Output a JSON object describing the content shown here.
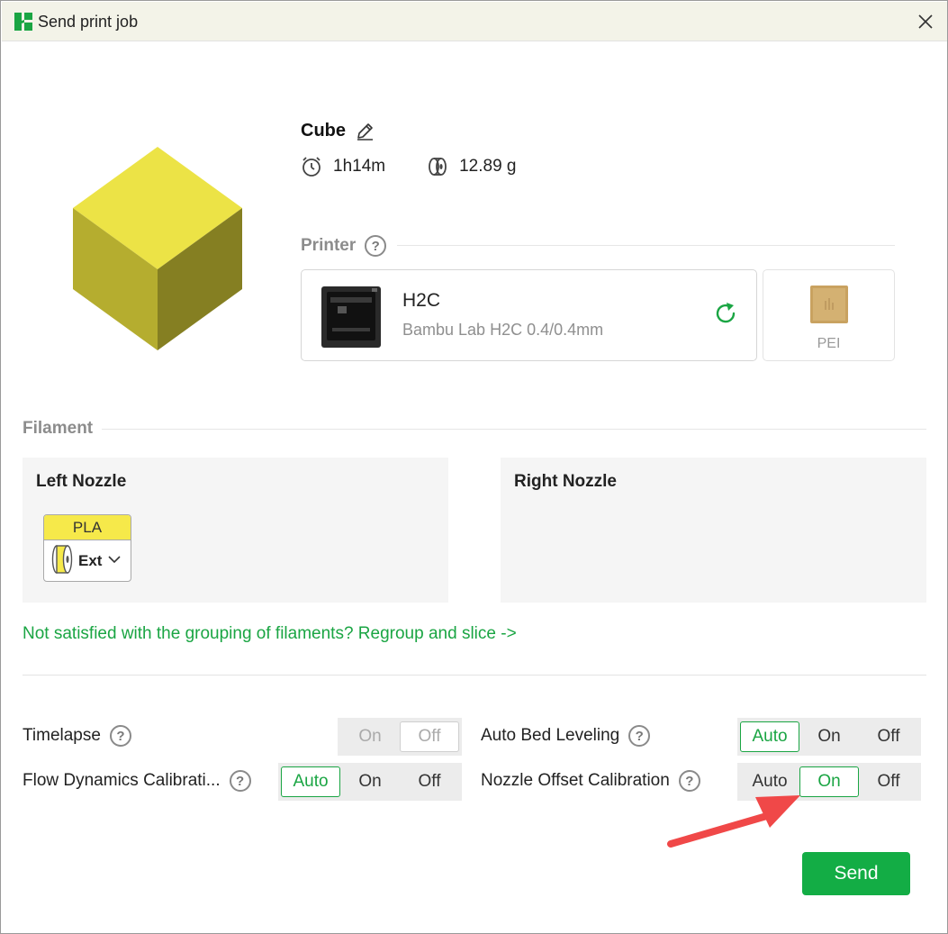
{
  "window": {
    "title": "Send print job",
    "icon": "bambu-logo-icon",
    "close_icon": "close-icon"
  },
  "model": {
    "name": "Cube",
    "time": "1h14m",
    "weight": "12.89 g",
    "color": "#e8de3e"
  },
  "printer": {
    "section_label": "Printer",
    "name": "H2C",
    "model": "Bambu Lab H2C  0.4/0.4mm",
    "plate_label": "PEI"
  },
  "filament": {
    "section_label": "Filament",
    "left_nozzle_title": "Left Nozzle",
    "right_nozzle_title": "Right Nozzle",
    "left_items": [
      {
        "type": "PLA",
        "slot": "Ext",
        "color": "#f6e94a"
      }
    ],
    "regroup_link": "Not satisfied with the grouping of filaments? Regroup and slice ->"
  },
  "options": {
    "timelapse": {
      "label": "Timelapse",
      "choices": [
        "On",
        "Off"
      ],
      "selected": "Off",
      "disabled": true
    },
    "auto_bed_leveling": {
      "label": "Auto Bed Leveling",
      "choices": [
        "Auto",
        "On",
        "Off"
      ],
      "selected": "Auto"
    },
    "flow_dynamics": {
      "label": "Flow Dynamics Calibrati...",
      "choices": [
        "Auto",
        "On",
        "Off"
      ],
      "selected": "Auto"
    },
    "nozzle_offset": {
      "label": "Nozzle Offset Calibration",
      "choices": [
        "Auto",
        "On",
        "Off"
      ],
      "selected": "On"
    }
  },
  "send_label": "Send",
  "colors": {
    "accent": "#1aa543",
    "send_button": "#13ad45",
    "annotation_arrow": "#f04848"
  }
}
